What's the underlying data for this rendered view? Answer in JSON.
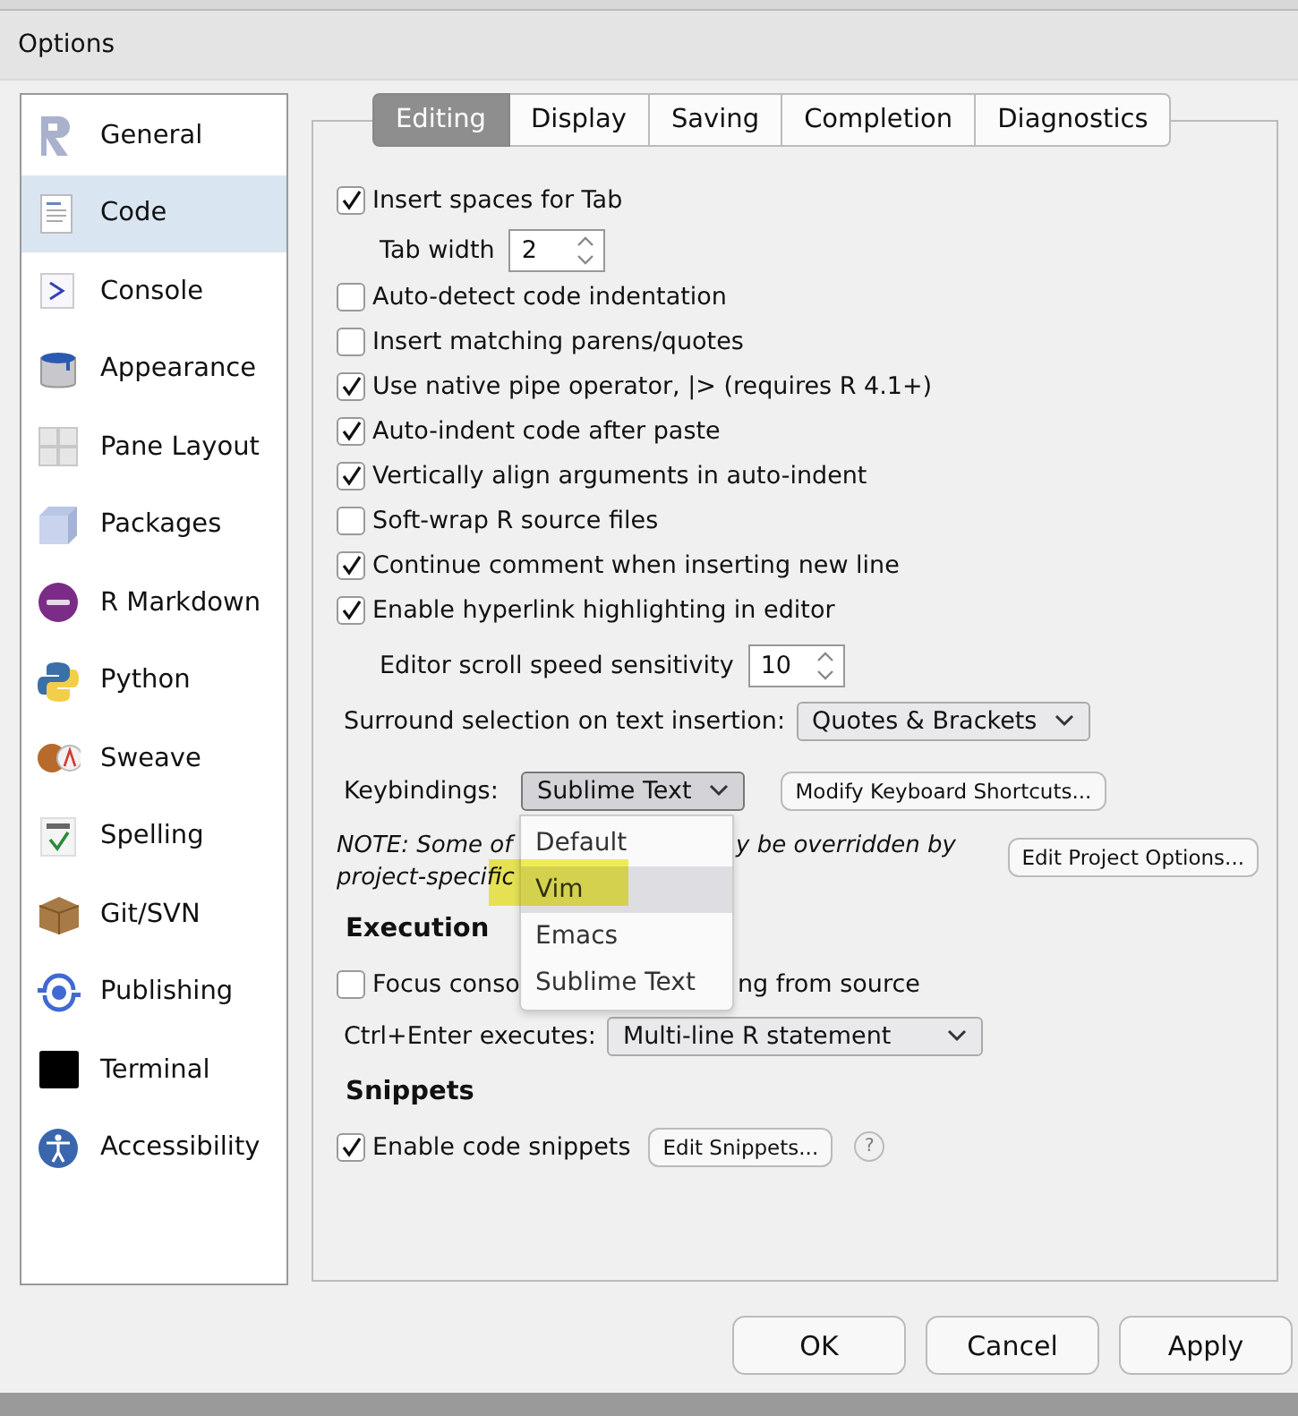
{
  "window": {
    "title": "Options"
  },
  "sidebar": {
    "items": [
      {
        "label": "General",
        "selected": false
      },
      {
        "label": "Code",
        "selected": true
      },
      {
        "label": "Console",
        "selected": false
      },
      {
        "label": "Appearance",
        "selected": false
      },
      {
        "label": "Pane Layout",
        "selected": false
      },
      {
        "label": "Packages",
        "selected": false
      },
      {
        "label": "R Markdown",
        "selected": false
      },
      {
        "label": "Python",
        "selected": false
      },
      {
        "label": "Sweave",
        "selected": false
      },
      {
        "label": "Spelling",
        "selected": false
      },
      {
        "label": "Git/SVN",
        "selected": false
      },
      {
        "label": "Publishing",
        "selected": false
      },
      {
        "label": "Terminal",
        "selected": false
      },
      {
        "label": "Accessibility",
        "selected": false
      }
    ]
  },
  "tabs": [
    {
      "label": "Editing",
      "selected": true
    },
    {
      "label": "Display",
      "selected": false
    },
    {
      "label": "Saving",
      "selected": false
    },
    {
      "label": "Completion",
      "selected": false
    },
    {
      "label": "Diagnostics",
      "selected": false
    }
  ],
  "settings": [
    {
      "kind": "checkbox",
      "label": "Insert spaces for Tab",
      "checked": true
    },
    {
      "kind": "spinner",
      "label": "Tab width",
      "value": "2"
    },
    {
      "kind": "checkbox",
      "label": "Auto-detect code indentation",
      "checked": false
    },
    {
      "kind": "checkbox",
      "label": "Insert matching parens/quotes",
      "checked": false
    },
    {
      "kind": "checkbox",
      "label": "Use native pipe operator, |> (requires R 4.1+)",
      "checked": true
    },
    {
      "kind": "checkbox",
      "label": "Auto-indent code after paste",
      "checked": true
    },
    {
      "kind": "checkbox",
      "label": "Vertically align arguments in auto-indent",
      "checked": true
    },
    {
      "kind": "checkbox",
      "label": "Soft-wrap R source files",
      "checked": false
    },
    {
      "kind": "checkbox",
      "label": "Continue comment when inserting new line",
      "checked": true
    },
    {
      "kind": "checkbox",
      "label": "Enable hyperlink highlighting in editor",
      "checked": true
    },
    {
      "kind": "spinner",
      "label": "Editor scroll speed sensitivity",
      "value": "10"
    },
    {
      "kind": "select",
      "label": "Surround selection on text insertion:",
      "value": "Quotes & Brackets"
    },
    {
      "kind": "keybindings",
      "label": "Keybindings:",
      "value": "Sublime Text",
      "button": "Modify Keyboard Shortcuts...",
      "expanded": true,
      "options": [
        {
          "label": "Default",
          "highlighted": false
        },
        {
          "label": "Vim",
          "highlighted": true
        },
        {
          "label": "Emacs",
          "highlighted": false
        },
        {
          "label": "Sublime Text",
          "highlighted": false
        }
      ]
    },
    {
      "kind": "note",
      "parts": [
        "NOTE: Some of",
        "y be overridden by"
      ],
      "second_line": "project-specific",
      "button": "Edit Project Options..."
    },
    {
      "kind": "heading",
      "label": "Execution"
    },
    {
      "kind": "split-checkbox",
      "parts": [
        "Focus conso",
        "ng from source"
      ],
      "checked": false
    },
    {
      "kind": "select",
      "label": "Ctrl+Enter executes:",
      "value": "Multi-line R statement",
      "wide": true
    },
    {
      "kind": "heading",
      "label": "Snippets"
    },
    {
      "kind": "checkbox",
      "label": "Enable code snippets",
      "checked": true,
      "button": "Edit Snippets...",
      "help": "?"
    }
  ],
  "buttons": [
    "OK",
    "Cancel",
    "Apply"
  ]
}
